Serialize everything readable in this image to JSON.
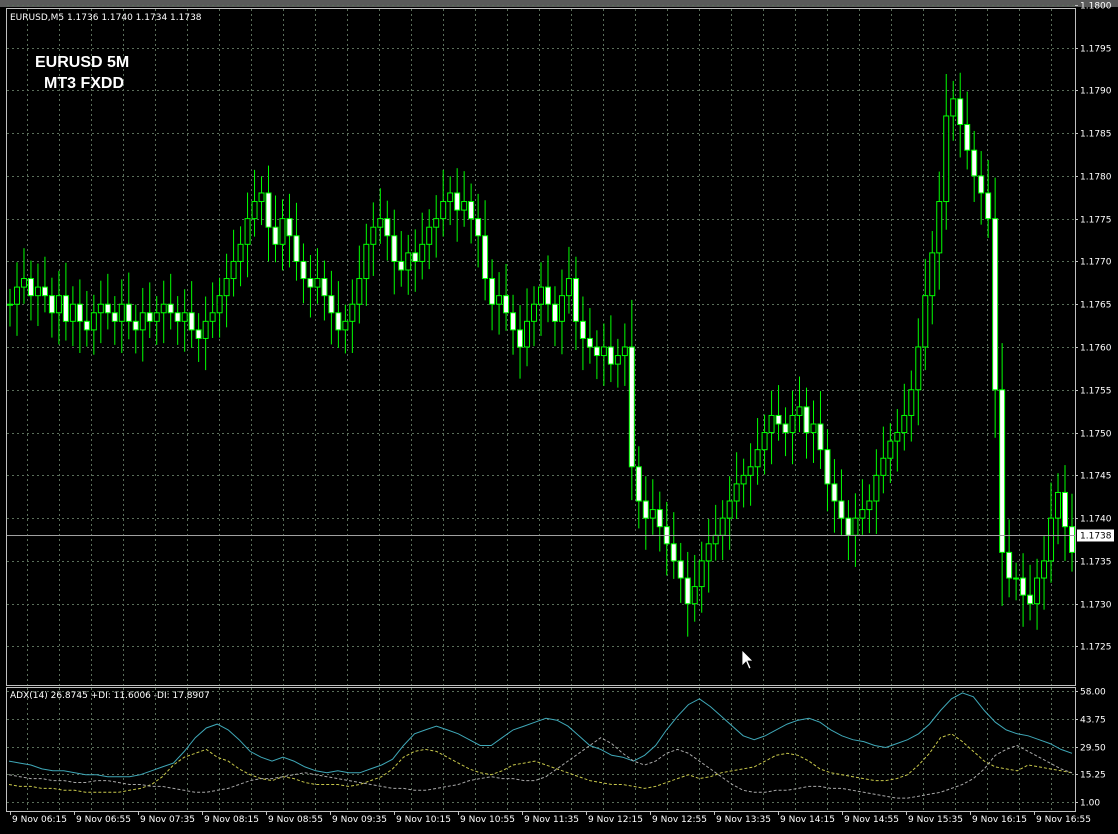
{
  "window": {
    "symbol_info": "EURUSD,M5  1.1736 1.1740 1.1734 1.1738",
    "watermark_line1": "EURUSD 5M",
    "watermark_line2": "MT3 FXDD"
  },
  "colors": {
    "background": "#000000",
    "grid": "#5a6e5a",
    "candle": "#00ff00",
    "frame": "#c0c0c0",
    "adx_line": "#3fa8b8",
    "plus_di_line": "#c8c84a",
    "minus_di_line": "#a8a8a8",
    "current_price_tag_bg": "#ffffff",
    "text": "#ffffff"
  },
  "current_price": {
    "value": 1.1738,
    "label": "1.1738"
  },
  "indicator": {
    "label": "ADX(14) 26.8745 +DI: 11.6006  -DI: 17.8907"
  },
  "chart_data": [
    {
      "type": "candlestick",
      "y_ticks": [
        "1.1800",
        "1.1795",
        "1.1790",
        "1.1785",
        "1.1780",
        "1.1775",
        "1.1770",
        "1.1765",
        "1.1760",
        "1.1755",
        "1.1750",
        "1.1745",
        "1.1740",
        "1.1735",
        "1.1730",
        "1.1725"
      ],
      "ylim": [
        1.17205,
        1.17995
      ],
      "x_ticks": [
        "9 Nov 06:15",
        "9 Nov 06:55",
        "9 Nov 07:35",
        "9 Nov 08:15",
        "9 Nov 08:55",
        "9 Nov 09:35",
        "9 Nov 10:15",
        "9 Nov 10:55",
        "9 Nov 11:35",
        "9 Nov 12:15",
        "9 Nov 12:55",
        "9 Nov 13:35",
        "9 Nov 14:15",
        "9 Nov 14:55",
        "9 Nov 15:35",
        "9 Nov 16:15",
        "9 Nov 16:55"
      ],
      "grid": true,
      "close_series": [
        1.1765,
        1.1767,
        1.1768,
        1.1766,
        1.1767,
        1.1766,
        1.1764,
        1.1766,
        1.1763,
        1.1765,
        1.1763,
        1.1762,
        1.1764,
        1.1765,
        1.1764,
        1.1763,
        1.1765,
        1.1763,
        1.1762,
        1.1764,
        1.1763,
        1.1764,
        1.1765,
        1.1764,
        1.1763,
        1.1764,
        1.1762,
        1.1761,
        1.1763,
        1.1764,
        1.1766,
        1.1768,
        1.177,
        1.1772,
        1.1775,
        1.1777,
        1.1778,
        1.1774,
        1.1772,
        1.1775,
        1.1773,
        1.177,
        1.1768,
        1.1767,
        1.1768,
        1.1766,
        1.1764,
        1.1762,
        1.1763,
        1.1765,
        1.1768,
        1.1772,
        1.1774,
        1.1775,
        1.1773,
        1.177,
        1.1769,
        1.1771,
        1.177,
        1.1772,
        1.1774,
        1.1775,
        1.1777,
        1.1778,
        1.1776,
        1.1777,
        1.1775,
        1.1773,
        1.1768,
        1.1765,
        1.1766,
        1.1764,
        1.1762,
        1.176,
        1.1763,
        1.1765,
        1.1767,
        1.1765,
        1.1763,
        1.1766,
        1.1768,
        1.1763,
        1.1761,
        1.176,
        1.1759,
        1.176,
        1.1758,
        1.1759,
        1.176,
        1.1746,
        1.1742,
        1.174,
        1.1741,
        1.1739,
        1.1737,
        1.1735,
        1.1733,
        1.173,
        1.1732,
        1.1735,
        1.1737,
        1.1738,
        1.174,
        1.1742,
        1.1744,
        1.1745,
        1.1746,
        1.1748,
        1.175,
        1.1752,
        1.1751,
        1.175,
        1.1752,
        1.1753,
        1.175,
        1.1751,
        1.1748,
        1.1744,
        1.1742,
        1.174,
        1.1738,
        1.174,
        1.1741,
        1.1742,
        1.1745,
        1.1747,
        1.1749,
        1.175,
        1.1752,
        1.1755,
        1.176,
        1.1766,
        1.1771,
        1.1777,
        1.1787,
        1.1789,
        1.1786,
        1.1783,
        1.178,
        1.1778,
        1.1775,
        1.1755,
        1.1736,
        1.1733,
        1.1733,
        1.1731,
        1.173,
        1.1733,
        1.1735,
        1.174,
        1.1743,
        1.1739,
        1.1736
      ]
    },
    {
      "type": "line",
      "indicator": "ADX",
      "y_ticks": [
        "58.00",
        "43.75",
        "29.50",
        "15.25",
        "1.00"
      ],
      "ylim": [
        1,
        58
      ],
      "series": [
        {
          "name": "ADX(14)",
          "values": [
            22,
            21,
            20,
            18,
            17,
            17,
            16,
            15,
            15,
            14,
            14,
            14,
            15,
            17,
            19,
            21,
            27,
            34,
            39,
            41,
            38,
            33,
            27,
            24,
            22,
            24,
            22,
            19,
            17,
            16,
            17,
            16,
            16,
            18,
            20,
            23,
            30,
            36,
            38,
            40,
            38,
            36,
            33,
            30,
            30,
            34,
            38,
            40,
            42,
            44,
            43,
            40,
            35,
            30,
            28,
            25,
            24,
            22,
            25,
            30,
            38,
            45,
            51,
            54,
            50,
            45,
            40,
            35,
            33,
            35,
            38,
            41,
            43,
            44,
            42,
            38,
            35,
            33,
            32,
            30,
            29,
            31,
            33,
            36,
            41,
            48,
            54,
            57,
            55,
            48,
            42,
            38,
            36,
            35,
            33,
            31,
            28,
            26
          ]
        },
        {
          "name": "+DI",
          "values": [
            10,
            9,
            9,
            8,
            8,
            7,
            7,
            6,
            6,
            6,
            6,
            7,
            8,
            10,
            14,
            20,
            24,
            26,
            28,
            24,
            22,
            18,
            15,
            13,
            12,
            14,
            13,
            11,
            10,
            10,
            10,
            9,
            10,
            12,
            14,
            18,
            24,
            27,
            28,
            27,
            24,
            21,
            18,
            16,
            15,
            17,
            20,
            21,
            22,
            20,
            18,
            16,
            14,
            12,
            11,
            10,
            10,
            9,
            8,
            9,
            11,
            13,
            15,
            13,
            14,
            16,
            17,
            18,
            19,
            22,
            25,
            26,
            25,
            22,
            18,
            16,
            15,
            14,
            13,
            12,
            12,
            13,
            15,
            20,
            26,
            34,
            36,
            32,
            27,
            22,
            19,
            18,
            17,
            20,
            19,
            18,
            17,
            16
          ]
        },
        {
          "name": "-DI",
          "values": [
            15,
            14,
            13,
            13,
            12,
            12,
            11,
            11,
            12,
            12,
            11,
            10,
            10,
            9,
            9,
            8,
            7,
            6,
            6,
            7,
            8,
            10,
            12,
            13,
            13,
            14,
            15,
            16,
            15,
            14,
            13,
            12,
            11,
            10,
            9,
            8,
            8,
            7,
            7,
            8,
            9,
            10,
            12,
            13,
            14,
            13,
            13,
            12,
            12,
            14,
            18,
            22,
            26,
            30,
            34,
            31,
            26,
            22,
            20,
            22,
            26,
            28,
            26,
            22,
            18,
            14,
            10,
            7,
            6,
            6,
            7,
            7,
            8,
            9,
            9,
            8,
            8,
            7,
            6,
            5,
            4,
            3,
            3,
            4,
            5,
            6,
            8,
            10,
            13,
            18,
            25,
            28,
            30,
            27,
            24,
            21,
            18,
            16
          ]
        }
      ]
    }
  ]
}
